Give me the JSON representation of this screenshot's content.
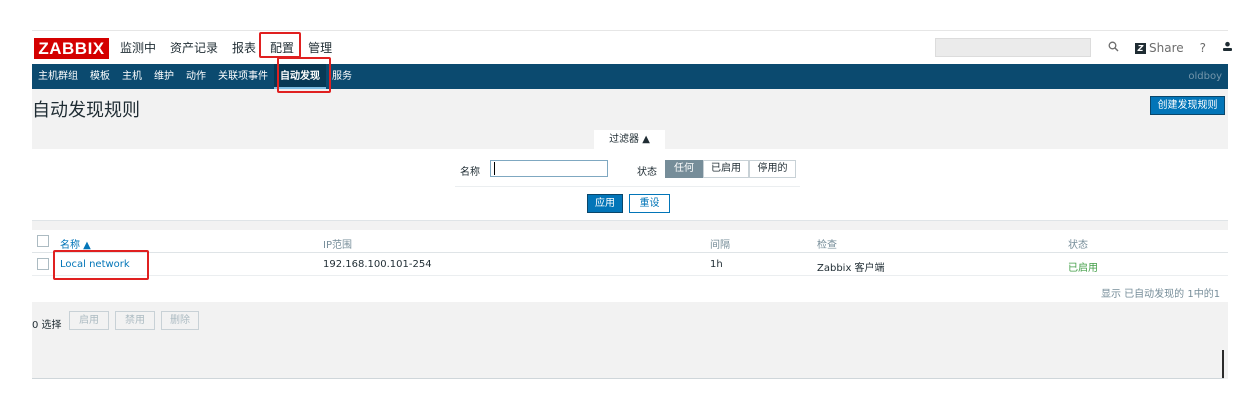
{
  "header": {
    "logo": "ZABBIX",
    "menu": [
      "监测中",
      "资产记录",
      "报表",
      "配置",
      "管理"
    ],
    "share_label": "Share",
    "help_icon": "?",
    "user_icon": "user-icon",
    "power_icon": "power-icon"
  },
  "navbar": {
    "items": [
      "主机群组",
      "模板",
      "主机",
      "维护",
      "动作",
      "关联项事件",
      "自动发现",
      "服务"
    ],
    "active": "自动发现",
    "user": "oldboy"
  },
  "page": {
    "title": "自动发现规则",
    "create_button": "创建发现规则"
  },
  "filter": {
    "tab_label": "过滤器 ▲",
    "name_label": "名称",
    "name_value": "",
    "status_label": "状态",
    "status_options": [
      "任何",
      "已启用",
      "停用的"
    ],
    "status_selected": "任何",
    "apply": "应用",
    "reset": "重设"
  },
  "table": {
    "columns": [
      "名称 ▲",
      "IP范围",
      "间隔",
      "检查",
      "状态"
    ],
    "rows": [
      {
        "name": "Local network",
        "ip_range": "192.168.100.101-254",
        "interval": "1h",
        "checks": "Zabbix 客户端",
        "status": "已启用"
      }
    ],
    "footer": "显示 已自动发现的 1中的1"
  },
  "actions": {
    "selected": "0 选择",
    "buttons": [
      "启用",
      "禁用",
      "删除"
    ]
  },
  "colors": {
    "navbar": "#0b4a6f",
    "primary": "#0275b8",
    "logo": "#d40000",
    "enabled": "#429e47",
    "highlight": "#e02020"
  }
}
